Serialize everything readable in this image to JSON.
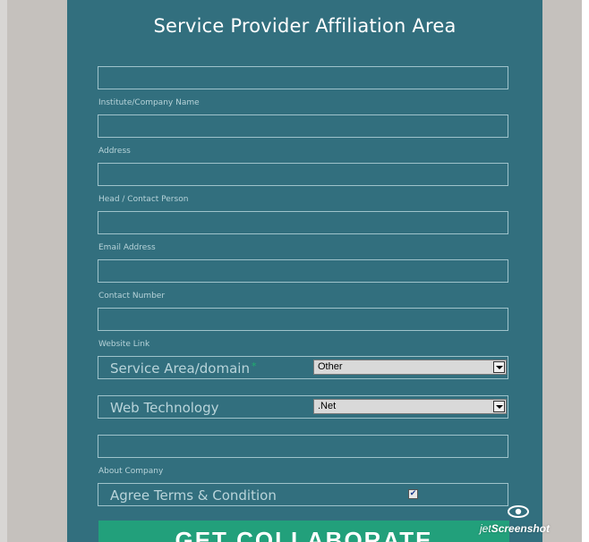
{
  "form": {
    "title": "Service Provider Affiliation Area",
    "fields": [
      {
        "caption": "Institute/Company Name",
        "value": ""
      },
      {
        "caption": "Address",
        "value": ""
      },
      {
        "caption": "Head / Contact Person",
        "value": ""
      },
      {
        "caption": "Email Address",
        "value": ""
      },
      {
        "caption": "Contact Number",
        "value": ""
      },
      {
        "caption": "Website Link",
        "value": ""
      }
    ],
    "service_area": {
      "label": "Service Area/domain",
      "required_mark": "*",
      "selected": "Other"
    },
    "web_technology": {
      "label": "Web Technology",
      "selected": ".Net"
    },
    "about_company": {
      "caption": "About Company",
      "value": ""
    },
    "agree_terms": {
      "label": "Agree Terms & Condition",
      "checked": true,
      "check_glyph": "✔"
    },
    "submit_label": "GET COLLABORATE"
  },
  "watermark": {
    "text_prefix": "jet",
    "text_main": "Screenshot"
  },
  "colors": {
    "panel": "#326f7e",
    "border": "#9fc3cb",
    "cta": "#22a07b",
    "required": "#1fb06e",
    "background": "#c5c1bd"
  }
}
